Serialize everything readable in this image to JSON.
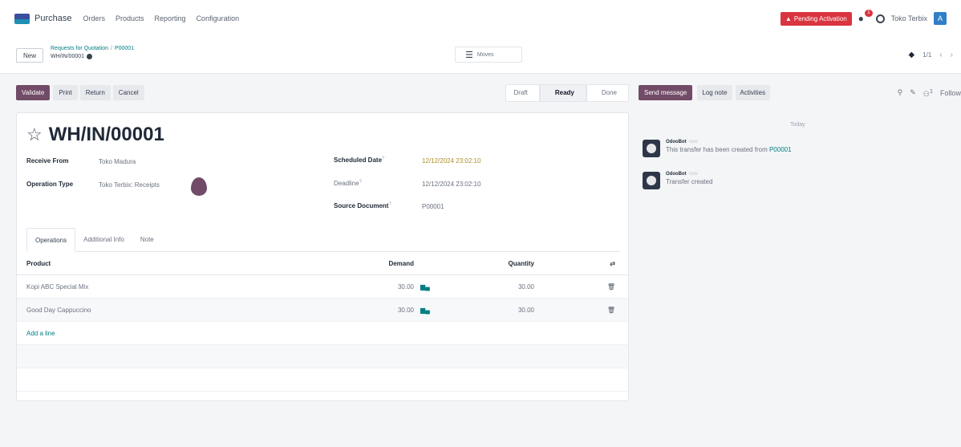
{
  "topnav": {
    "app_name": "Purchase",
    "menu": [
      "Orders",
      "Products",
      "Reporting",
      "Configuration"
    ],
    "pending_label": "Pending Activation",
    "chat_badge": "1",
    "company": "Toko Terbix",
    "avatar_letter": "A"
  },
  "control": {
    "new_label": "New",
    "breadcrumb_parent": "Requests for Quotation",
    "breadcrumb_sep": "/",
    "breadcrumb_po": "P00001",
    "record_name": "WH/IN/00001",
    "moves_label": "Moves",
    "pager": "1/1"
  },
  "actions": {
    "validate": "Validate",
    "print": "Print",
    "return": "Return",
    "cancel": "Cancel"
  },
  "status": {
    "stages": [
      "Draft",
      "Ready",
      "Done"
    ],
    "active": "Ready"
  },
  "form": {
    "title": "WH/IN/00001",
    "receive_from_label": "Receive From",
    "receive_from": "Toko Madura",
    "operation_type_label": "Operation Type",
    "operation_type": "Toko Terbix: Receipts",
    "scheduled_date_label": "Scheduled Date",
    "scheduled_date": "12/12/2024 23:02:10",
    "deadline_label": "Deadline",
    "deadline": "12/12/2024 23:02:10",
    "source_document_label": "Source Document",
    "source_document": "P00001",
    "required_mark": "?"
  },
  "tabs": [
    "Operations",
    "Additional Info",
    "Note"
  ],
  "table": {
    "headers": {
      "product": "Product",
      "demand": "Demand",
      "quantity": "Quantity"
    },
    "rows": [
      {
        "product": "Kopi ABC Special Mix",
        "demand": "30.00",
        "quantity": "30.00"
      },
      {
        "product": "Good Day Cappuccino",
        "demand": "30.00",
        "quantity": "30.00"
      }
    ],
    "add_line": "Add a line"
  },
  "chatter": {
    "send_message": "Send message",
    "log_note": "Log note",
    "activities": "Activities",
    "follow": "Follow",
    "attach_count": "1",
    "today": "Today",
    "messages": [
      {
        "author": "OdooBot",
        "time": "now",
        "text": "This transfer has been created from",
        "link": "P00001"
      },
      {
        "author": "OdooBot",
        "time": "now",
        "text": "Transfer created",
        "link": ""
      }
    ]
  }
}
